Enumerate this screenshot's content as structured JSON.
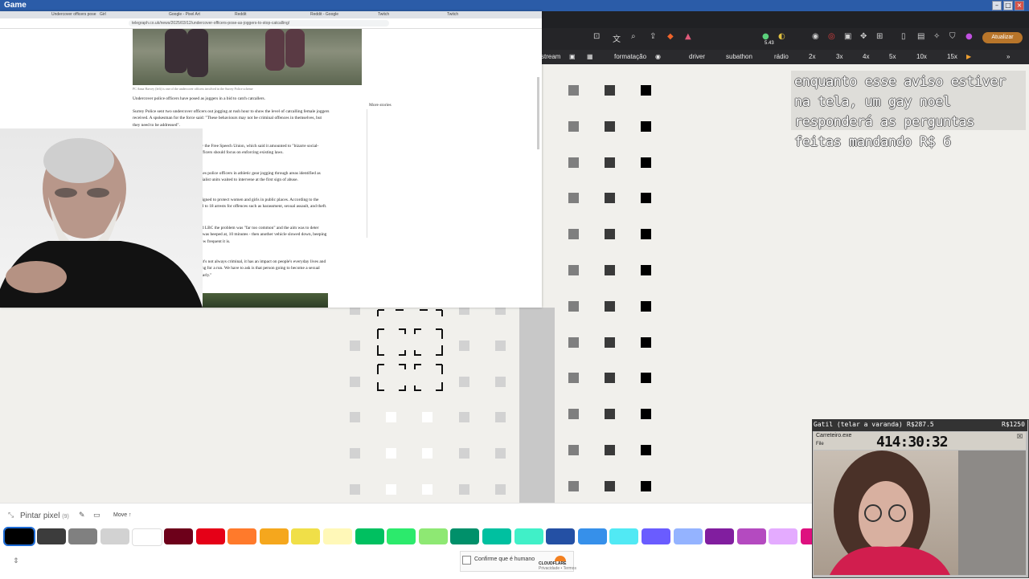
{
  "window": {
    "title": "Game"
  },
  "browser": {
    "tabs": [
      "Undercover officers pose as...",
      "Girl",
      "Google - Pixel Art",
      "Reddit",
      "Reddit - Google",
      "Twitch",
      "Twitch"
    ],
    "url": "telegraph.co.uk/news/2025/03/12/undercover-officers-pose-as-joggers-to-stop-catcalling/",
    "article": {
      "caption": "PC Anna Harvey (left) is one of the undercover officers involved in the Surrey Police scheme",
      "paragraphs": [
        "Undercover police officers have posed as joggers in a bid to catch catcallers.",
        "Surrey Police sent two undercover officers out jogging at rush hour to show the level of catcalling female joggers received. A spokesman for the force said: \"These behaviours may not be criminal offences in themselves, but they need to be addressed\".",
        "However, the operation was criticised by the Free Speech Union, which said it amounted to \"bizarre social-psychology experiments\", adding that officers should focus on enforcing existing laws.",
        "First reported by LBC, it saw plain clothes police officers in athletic gear jogging through areas identified as harassment hot spots, while nearby specialist units waited to intervene at the first sign of abuse.",
        "Surrey Police said the approach was designed to protect women and girls in public places. According to the force, the trial, which lasted a month, led to 18 arrests for offences such as harassment, sexual assault, and theft.",
        "Inspector Jon Vale, of Surrey Police, told LBC the problem was \"far too common\" and the aim was to deter offenders. He said: \"One of our officers was beeped at, 10 minutes - then another vehicle slowed down, beeping and shouting, 30 seconds later - that's how frequent it is.",
        "\"It's beeping, staring, shouting - even if it's not always criminal, it has an impact on people's everyday lives and stops women from doing things like going for a run. We have to ask is that person going to become a sexual offender? We want to manage that risk early.\""
      ],
      "more_stories": "More stories"
    }
  },
  "toolbar": {
    "counter": "5.43",
    "update_button": "Atualizar"
  },
  "bookmarks": [
    "stream",
    "formatação",
    "driver",
    "subathon",
    "rádio",
    "2x",
    "3x",
    "4x",
    "5x",
    "10x",
    "15x"
  ],
  "notice_text": "enquanto esse aviso estiver na tela, um gay noel responderá as perguntas feitas mandando R$ 6",
  "tool": {
    "label": "Pintar pixel",
    "count": "(9)",
    "move_label": "Move ↑"
  },
  "palette": [
    "#000000",
    "#3c3c3c",
    "#808080",
    "#d2d2d2",
    "#ffffff",
    "#6d001a",
    "#e50017",
    "#ff7a2b",
    "#f5a71d",
    "#f0df48",
    "#fff8b8",
    "#00c060",
    "#2cea6c",
    "#8ee873",
    "#00906a",
    "#00c0a0",
    "#40f0c8",
    "#2450a4",
    "#3690ea",
    "#51e9f4",
    "#6a5cff",
    "#94b3ff",
    "#811e9f",
    "#b44ac0",
    "#e4abff",
    "#de107f"
  ],
  "captcha": {
    "label": "Confirme que é humano",
    "brand": "CLOUDFLARE",
    "links": "Privacidade • Termos"
  },
  "widget": {
    "title": "Gatil (telar a varanda)",
    "price1": "R$287.5",
    "price2": "R$1250",
    "window_name": "Carreteiro.exe",
    "menu": "File",
    "timer": "414:30:32"
  }
}
